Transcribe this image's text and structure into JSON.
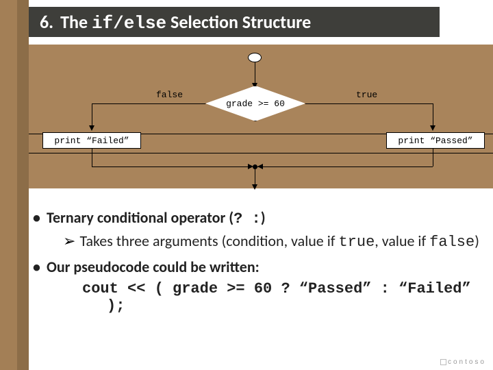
{
  "title": {
    "index": "6.",
    "pre": "The",
    "code": "if/else",
    "post": "Selection Structure"
  },
  "flowchart": {
    "condition": "grade >= 60",
    "false_label": "false",
    "true_label": "true",
    "false_action": "print “Failed”",
    "true_action": "print “Passed”"
  },
  "bullets": {
    "b1_pre": "Ternary conditional operator (",
    "b1_code": "? :",
    "b1_post": ")",
    "sub_pre": "Takes three arguments (condition, value if ",
    "sub_code1": "true",
    "sub_mid": ", value if ",
    "sub_code2": "false",
    "sub_post": ")",
    "b2": "Our pseudocode could be written:",
    "code_line": "cout << ( grade >= 60 ? “Passed” : “Failed” );"
  },
  "logo": "contoso"
}
